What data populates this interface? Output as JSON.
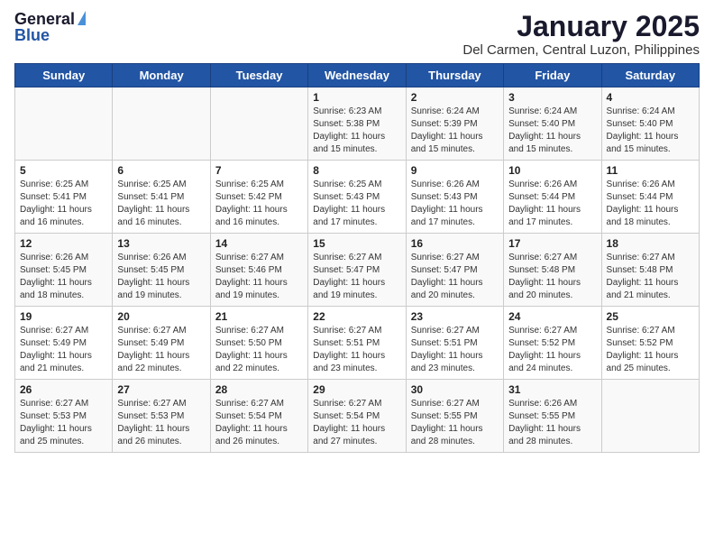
{
  "header": {
    "logo_general": "General",
    "logo_blue": "Blue",
    "title": "January 2025",
    "subtitle": "Del Carmen, Central Luzon, Philippines"
  },
  "days_of_week": [
    "Sunday",
    "Monday",
    "Tuesday",
    "Wednesday",
    "Thursday",
    "Friday",
    "Saturday"
  ],
  "weeks": [
    [
      {
        "day": "",
        "info": ""
      },
      {
        "day": "",
        "info": ""
      },
      {
        "day": "",
        "info": ""
      },
      {
        "day": "1",
        "info": "Sunrise: 6:23 AM\nSunset: 5:38 PM\nDaylight: 11 hours and 15 minutes."
      },
      {
        "day": "2",
        "info": "Sunrise: 6:24 AM\nSunset: 5:39 PM\nDaylight: 11 hours and 15 minutes."
      },
      {
        "day": "3",
        "info": "Sunrise: 6:24 AM\nSunset: 5:40 PM\nDaylight: 11 hours and 15 minutes."
      },
      {
        "day": "4",
        "info": "Sunrise: 6:24 AM\nSunset: 5:40 PM\nDaylight: 11 hours and 15 minutes."
      }
    ],
    [
      {
        "day": "5",
        "info": "Sunrise: 6:25 AM\nSunset: 5:41 PM\nDaylight: 11 hours and 16 minutes."
      },
      {
        "day": "6",
        "info": "Sunrise: 6:25 AM\nSunset: 5:41 PM\nDaylight: 11 hours and 16 minutes."
      },
      {
        "day": "7",
        "info": "Sunrise: 6:25 AM\nSunset: 5:42 PM\nDaylight: 11 hours and 16 minutes."
      },
      {
        "day": "8",
        "info": "Sunrise: 6:25 AM\nSunset: 5:43 PM\nDaylight: 11 hours and 17 minutes."
      },
      {
        "day": "9",
        "info": "Sunrise: 6:26 AM\nSunset: 5:43 PM\nDaylight: 11 hours and 17 minutes."
      },
      {
        "day": "10",
        "info": "Sunrise: 6:26 AM\nSunset: 5:44 PM\nDaylight: 11 hours and 17 minutes."
      },
      {
        "day": "11",
        "info": "Sunrise: 6:26 AM\nSunset: 5:44 PM\nDaylight: 11 hours and 18 minutes."
      }
    ],
    [
      {
        "day": "12",
        "info": "Sunrise: 6:26 AM\nSunset: 5:45 PM\nDaylight: 11 hours and 18 minutes."
      },
      {
        "day": "13",
        "info": "Sunrise: 6:26 AM\nSunset: 5:45 PM\nDaylight: 11 hours and 19 minutes."
      },
      {
        "day": "14",
        "info": "Sunrise: 6:27 AM\nSunset: 5:46 PM\nDaylight: 11 hours and 19 minutes."
      },
      {
        "day": "15",
        "info": "Sunrise: 6:27 AM\nSunset: 5:47 PM\nDaylight: 11 hours and 19 minutes."
      },
      {
        "day": "16",
        "info": "Sunrise: 6:27 AM\nSunset: 5:47 PM\nDaylight: 11 hours and 20 minutes."
      },
      {
        "day": "17",
        "info": "Sunrise: 6:27 AM\nSunset: 5:48 PM\nDaylight: 11 hours and 20 minutes."
      },
      {
        "day": "18",
        "info": "Sunrise: 6:27 AM\nSunset: 5:48 PM\nDaylight: 11 hours and 21 minutes."
      }
    ],
    [
      {
        "day": "19",
        "info": "Sunrise: 6:27 AM\nSunset: 5:49 PM\nDaylight: 11 hours and 21 minutes."
      },
      {
        "day": "20",
        "info": "Sunrise: 6:27 AM\nSunset: 5:49 PM\nDaylight: 11 hours and 22 minutes."
      },
      {
        "day": "21",
        "info": "Sunrise: 6:27 AM\nSunset: 5:50 PM\nDaylight: 11 hours and 22 minutes."
      },
      {
        "day": "22",
        "info": "Sunrise: 6:27 AM\nSunset: 5:51 PM\nDaylight: 11 hours and 23 minutes."
      },
      {
        "day": "23",
        "info": "Sunrise: 6:27 AM\nSunset: 5:51 PM\nDaylight: 11 hours and 23 minutes."
      },
      {
        "day": "24",
        "info": "Sunrise: 6:27 AM\nSunset: 5:52 PM\nDaylight: 11 hours and 24 minutes."
      },
      {
        "day": "25",
        "info": "Sunrise: 6:27 AM\nSunset: 5:52 PM\nDaylight: 11 hours and 25 minutes."
      }
    ],
    [
      {
        "day": "26",
        "info": "Sunrise: 6:27 AM\nSunset: 5:53 PM\nDaylight: 11 hours and 25 minutes."
      },
      {
        "day": "27",
        "info": "Sunrise: 6:27 AM\nSunset: 5:53 PM\nDaylight: 11 hours and 26 minutes."
      },
      {
        "day": "28",
        "info": "Sunrise: 6:27 AM\nSunset: 5:54 PM\nDaylight: 11 hours and 26 minutes."
      },
      {
        "day": "29",
        "info": "Sunrise: 6:27 AM\nSunset: 5:54 PM\nDaylight: 11 hours and 27 minutes."
      },
      {
        "day": "30",
        "info": "Sunrise: 6:27 AM\nSunset: 5:55 PM\nDaylight: 11 hours and 28 minutes."
      },
      {
        "day": "31",
        "info": "Sunrise: 6:26 AM\nSunset: 5:55 PM\nDaylight: 11 hours and 28 minutes."
      },
      {
        "day": "",
        "info": ""
      }
    ]
  ]
}
